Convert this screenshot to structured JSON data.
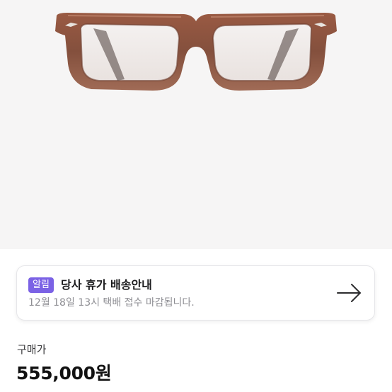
{
  "product": {
    "image_alt": "brown eyeglasses frame",
    "frame_color": "#8a4e3a"
  },
  "notice": {
    "badge": "알림",
    "title": "당사 휴가 배송안내",
    "description": "12월 18일 13시 택배 접수 마감됩니다.",
    "badge_color": "#7b62e5",
    "icon": "arrow-right-icon"
  },
  "price": {
    "label": "구매가",
    "value": "555,000원"
  }
}
